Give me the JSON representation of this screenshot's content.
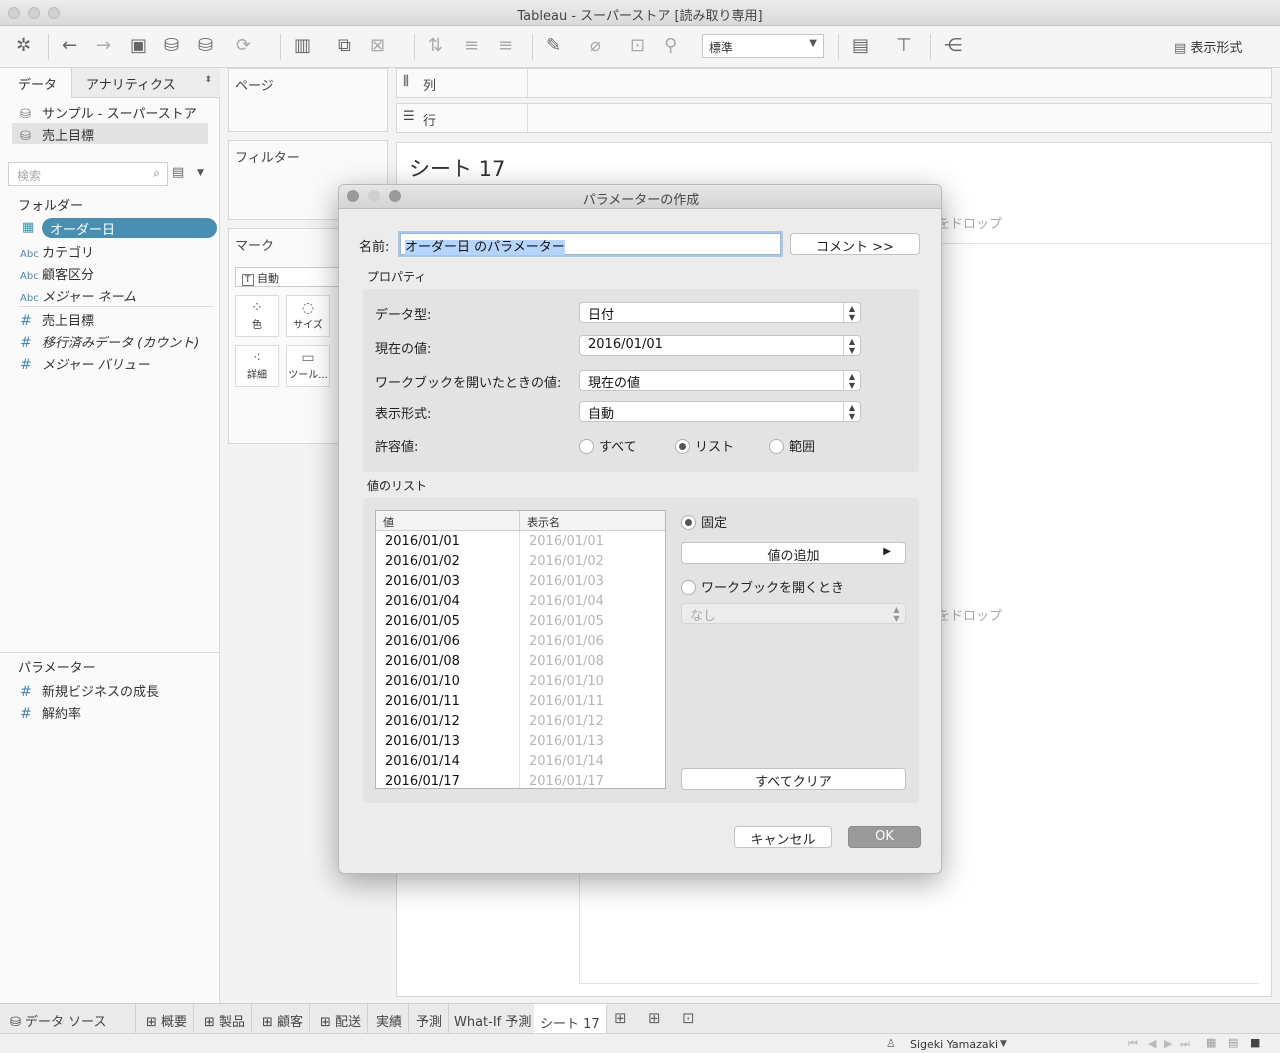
{
  "window": {
    "title": "Tableau - スーパーストア [読み取り専用]"
  },
  "toolbar": {
    "standard_select": "標準",
    "format_label": "表示形式"
  },
  "left_panel": {
    "tabs": [
      "データ",
      "アナリティクス"
    ],
    "datasources": [
      "サンプル - スーパーストア",
      "売上目標"
    ],
    "search_placeholder": "検索",
    "folder_header": "フォルダー",
    "fields": [
      {
        "icon": "calendar",
        "label": "オーダー日"
      },
      {
        "icon": "Abc",
        "label": "カテゴリ"
      },
      {
        "icon": "Abc",
        "label": "顧客区分"
      },
      {
        "icon": "Abc",
        "label": "メジャー ネーム"
      },
      {
        "icon": "#",
        "label": "売上目標"
      },
      {
        "icon": "#",
        "label": "移行済みデータ (カウント)"
      },
      {
        "icon": "#",
        "label": "メジャー バリュー"
      }
    ],
    "params_header": "パラメーター",
    "params": [
      {
        "icon": "#",
        "label": "新規ビジネスの成長"
      },
      {
        "icon": "#",
        "label": "解約率"
      }
    ]
  },
  "shelves": {
    "pages": "ページ",
    "filters": "フィルター",
    "marks": "マーク",
    "columns": "列",
    "rows": "行",
    "mark_type": "自動",
    "mark_buttons": [
      "色",
      "サイズ",
      "詳細",
      "ツール..."
    ]
  },
  "canvas": {
    "sheet_title": "シート 17",
    "drop_hint_1": "をドロップ",
    "drop_hint_2": "をドロップ"
  },
  "dialog": {
    "title": "パラメーターの作成",
    "name_label": "名前:",
    "name_value": "オーダー日 のパラメーター",
    "comment_button": "コメント >>",
    "properties_header": "プロパティ",
    "data_type_label": "データ型:",
    "data_type_value": "日付",
    "current_value_label": "現在の値:",
    "current_value_value": "2016/01/01",
    "workbook_open_label": "ワークブックを開いたときの値:",
    "workbook_open_value": "現在の値",
    "display_format_label": "表示形式:",
    "display_format_value": "自動",
    "allowable_label": "許容値:",
    "allowable_options": [
      "すべて",
      "リスト",
      "範囲"
    ],
    "allowable_selected": "リスト",
    "value_list_header": "値のリスト",
    "list_columns": [
      "値",
      "表示名"
    ],
    "list_rows": [
      [
        "2016/01/01",
        "2016/01/01"
      ],
      [
        "2016/01/02",
        "2016/01/02"
      ],
      [
        "2016/01/03",
        "2016/01/03"
      ],
      [
        "2016/01/04",
        "2016/01/04"
      ],
      [
        "2016/01/05",
        "2016/01/05"
      ],
      [
        "2016/01/06",
        "2016/01/06"
      ],
      [
        "2016/01/08",
        "2016/01/08"
      ],
      [
        "2016/01/10",
        "2016/01/10"
      ],
      [
        "2016/01/11",
        "2016/01/11"
      ],
      [
        "2016/01/12",
        "2016/01/12"
      ],
      [
        "2016/01/13",
        "2016/01/13"
      ],
      [
        "2016/01/14",
        "2016/01/14"
      ],
      [
        "2016/01/17",
        "2016/01/17"
      ]
    ],
    "fixed_label": "固定",
    "add_value_button": "値の追加",
    "on_open_label": "ワークブックを開くとき",
    "on_open_value": "なし",
    "clear_all_button": "すべてクリア",
    "cancel_button": "キャンセル",
    "ok_button": "OK"
  },
  "bottom_tabs": [
    "データ ソース",
    "概要",
    "製品",
    "顧客",
    "配送",
    "実績",
    "予測",
    "What-If 予測",
    "シート 17"
  ],
  "active_tab": "シート 17",
  "status": {
    "user": "Sigeki Yamazaki"
  }
}
